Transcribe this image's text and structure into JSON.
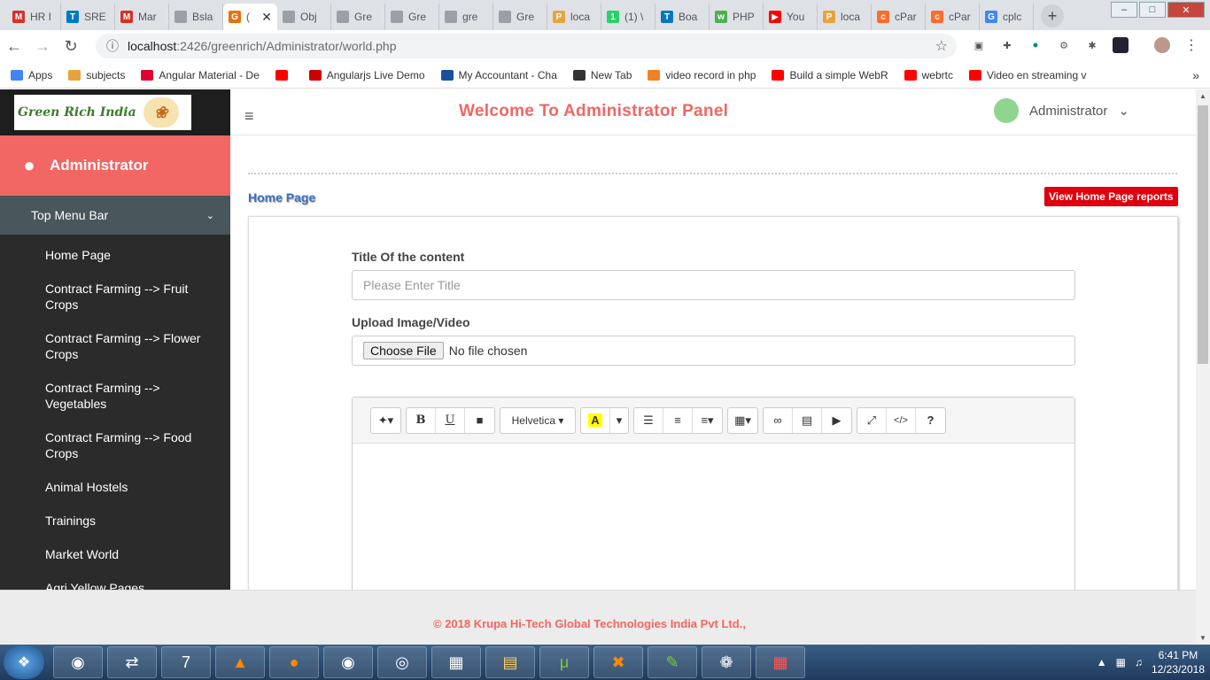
{
  "browser": {
    "tabs": [
      {
        "title": "HR I",
        "icon": "gmail-icon",
        "color": "#d93025",
        "glyph": "M"
      },
      {
        "title": "SRE",
        "icon": "trello-icon",
        "color": "#0079bf",
        "glyph": "T"
      },
      {
        "title": "Mar",
        "icon": "gmail-icon",
        "color": "#d93025",
        "glyph": "M"
      },
      {
        "title": "Bsla",
        "icon": "document-icon",
        "color": "#9aa0a6",
        "glyph": ""
      },
      {
        "title": "(",
        "icon": "page-icon",
        "color": "#e8710a",
        "glyph": "G",
        "active": true
      },
      {
        "title": "Obj",
        "icon": "document-icon",
        "color": "#9aa0a6",
        "glyph": ""
      },
      {
        "title": "Gre",
        "icon": "document-icon",
        "color": "#9aa0a6",
        "glyph": ""
      },
      {
        "title": "Gre",
        "icon": "document-icon",
        "color": "#9aa0a6",
        "glyph": ""
      },
      {
        "title": "gre",
        "icon": "document-icon",
        "color": "#9aa0a6",
        "glyph": ""
      },
      {
        "title": "Gre",
        "icon": "document-icon",
        "color": "#9aa0a6",
        "glyph": ""
      },
      {
        "title": "loca",
        "icon": "phpmyadmin-icon",
        "color": "#e8a33d",
        "glyph": "P"
      },
      {
        "title": "(1) \\",
        "icon": "whatsapp-icon",
        "color": "#25d366",
        "glyph": "1"
      },
      {
        "title": "Boa",
        "icon": "trello-icon",
        "color": "#0079bf",
        "glyph": "T"
      },
      {
        "title": "PHP",
        "icon": "w3-icon",
        "color": "#4caf50",
        "glyph": "w"
      },
      {
        "title": "You",
        "icon": "youtube-icon",
        "color": "#ff0000",
        "glyph": "▶"
      },
      {
        "title": "loca",
        "icon": "phpmyadmin-icon",
        "color": "#e8a33d",
        "glyph": "P"
      },
      {
        "title": "cPar",
        "icon": "cpanel-icon",
        "color": "#ff6c2c",
        "glyph": "c"
      },
      {
        "title": "cPar",
        "icon": "cpanel-icon",
        "color": "#ff6c2c",
        "glyph": "c"
      },
      {
        "title": "cplc",
        "icon": "google-icon",
        "color": "#4285f4",
        "glyph": "G"
      }
    ],
    "url_host": "localhost",
    "url_path": ":2426/greenrich/Administrator/world.php",
    "bookmarks": [
      {
        "label": "Apps",
        "icon": "apps-icon",
        "color": "#4285f4"
      },
      {
        "label": "subjects",
        "icon": "phpmyadmin-icon",
        "color": "#e8a33d"
      },
      {
        "label": "Angular Material - De",
        "icon": "angular-icon",
        "color": "#dd0031"
      },
      {
        "label": "",
        "icon": "youtube-icon",
        "color": "#ff0000"
      },
      {
        "label": "Angularjs Live Demo",
        "icon": "vivaldi-icon",
        "color": "#c00"
      },
      {
        "label": "My Accountant - Cha",
        "icon": "bookmark-icon",
        "color": "#1a4fa0"
      },
      {
        "label": "New Tab",
        "icon": "newtab-icon",
        "color": "#333"
      },
      {
        "label": "video record in php",
        "icon": "stackoverflow-icon",
        "color": "#f48024"
      },
      {
        "label": "Build a simple WebR",
        "icon": "youtube-icon",
        "color": "#ff0000"
      },
      {
        "label": "webrtc",
        "icon": "youtube-icon",
        "color": "#ff0000"
      },
      {
        "label": "Video en streaming v",
        "icon": "youtube-icon",
        "color": "#ff0000"
      }
    ]
  },
  "sidebar": {
    "logo_text": "Green Rich India",
    "admin_label": "Administrator",
    "top_menu_label": "Top Menu Bar",
    "items": [
      "Home Page",
      "Contract Farming --> Fruit Crops",
      "Contract Farming --> Flower Crops",
      "Contract Farming --> Vegetables",
      "Contract Farming --> Food Crops",
      "Animal Hostels",
      "Trainings",
      "Market World",
      "Agri Yellow Pages"
    ]
  },
  "header": {
    "welcome": "Welcome To Administrator Panel",
    "user": "Administrator"
  },
  "main": {
    "breadcrumb": "Home Page",
    "report_button": "View Home Page reports",
    "title_label": "Title Of the content",
    "title_placeholder": "Please Enter Title",
    "upload_label": "Upload Image/Video",
    "choose_file": "Choose File",
    "no_file": "No file chosen",
    "editor": {
      "font": "Helvetica"
    }
  },
  "footer": {
    "copyright": "© 2018 Krupa Hi-Tech Global Technologies India Pvt Ltd.,"
  },
  "taskbar": {
    "time": "6:41 PM",
    "date": "12/23/2018"
  },
  "colors": {
    "accent": "#f26663",
    "sidebar": "#2b2b2b",
    "report_button": "#e0000d",
    "breadcrumb": "#3b6fc4"
  }
}
